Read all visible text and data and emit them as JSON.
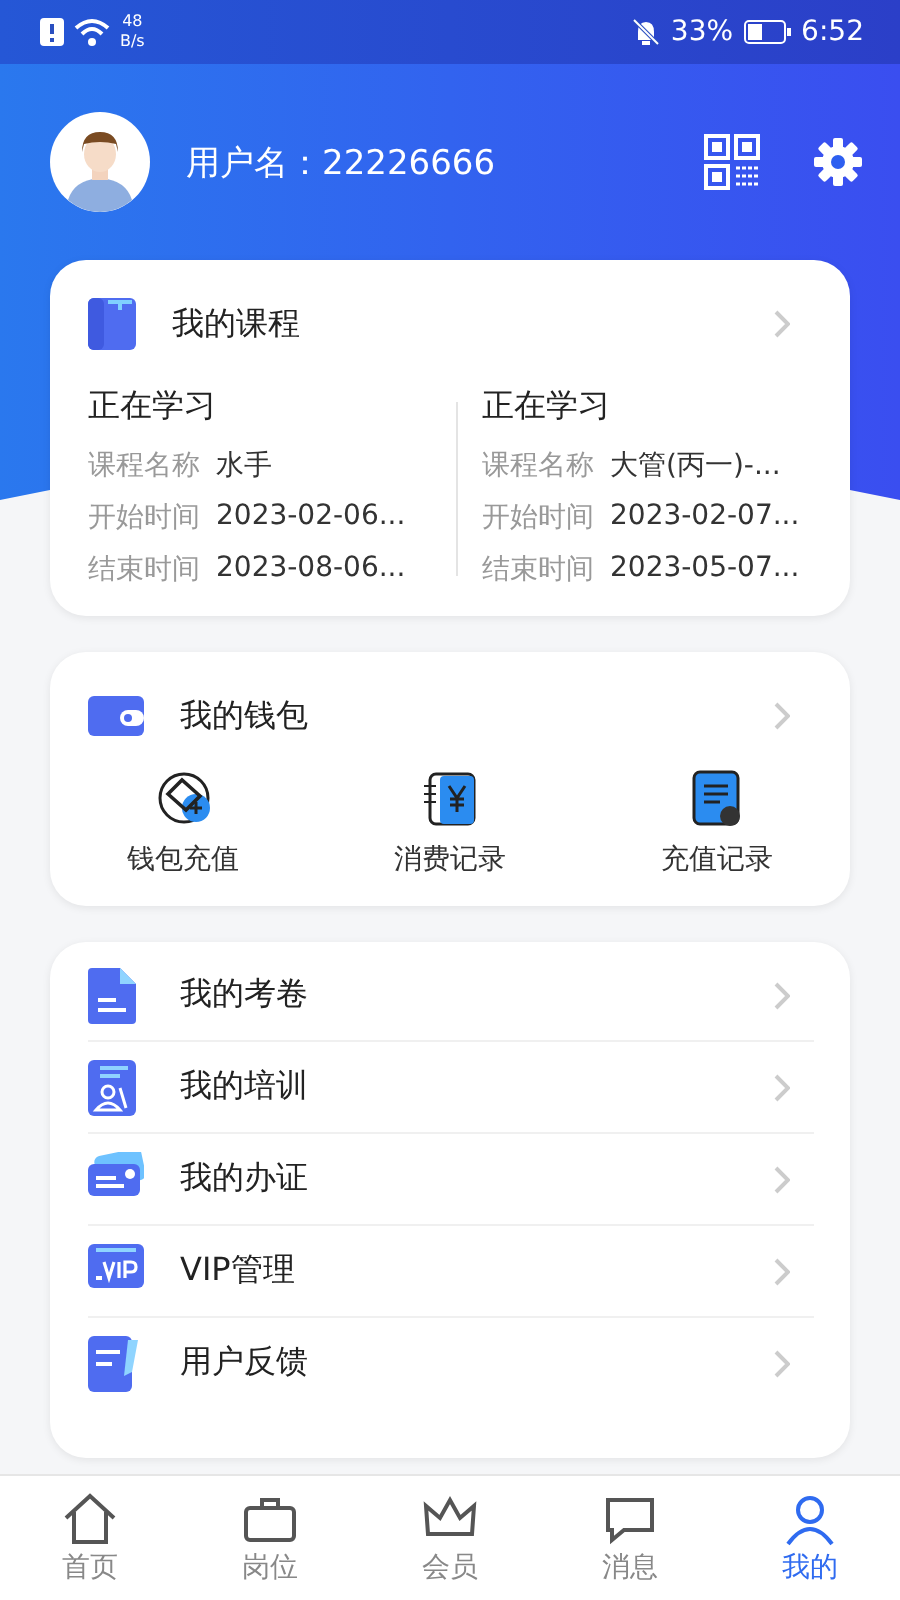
{
  "status_bar": {
    "speed_value": "48",
    "speed_unit": "B/s",
    "battery": "33%",
    "time": "6:52"
  },
  "profile": {
    "username": "用户名：22226666"
  },
  "courses": {
    "title": "我的课程",
    "columns": [
      {
        "heading": "正在学习",
        "rows": [
          {
            "label": "课程名称",
            "value": "水手"
          },
          {
            "label": "开始时间",
            "value": "2023-02-06..."
          },
          {
            "label": "结束时间",
            "value": "2023-08-06..."
          }
        ]
      },
      {
        "heading": "正在学习",
        "rows": [
          {
            "label": "课程名称",
            "value": "大管(丙一)-..."
          },
          {
            "label": "开始时间",
            "value": "2023-02-07..."
          },
          {
            "label": "结束时间",
            "value": "2023-05-07..."
          }
        ]
      }
    ]
  },
  "wallet": {
    "title": "我的钱包",
    "actions": [
      {
        "label": "钱包充值",
        "kind": "topup"
      },
      {
        "label": "消费记录",
        "kind": "spending"
      },
      {
        "label": "充值记录",
        "kind": "recharge"
      }
    ]
  },
  "menu": [
    {
      "label": "我的考卷",
      "kind": "exam"
    },
    {
      "label": "我的培训",
      "kind": "training"
    },
    {
      "label": "我的办证",
      "kind": "certificate"
    },
    {
      "label": "VIP管理",
      "kind": "vip"
    },
    {
      "label": "用户反馈",
      "kind": "feedback"
    }
  ],
  "tab_bar": [
    {
      "label": "首页",
      "kind": "home",
      "selected": false
    },
    {
      "label": "岗位",
      "kind": "jobs",
      "selected": false
    },
    {
      "label": "会员",
      "kind": "member",
      "selected": false
    },
    {
      "label": "消息",
      "kind": "message",
      "selected": false
    },
    {
      "label": "我的",
      "kind": "me",
      "selected": true
    }
  ]
}
